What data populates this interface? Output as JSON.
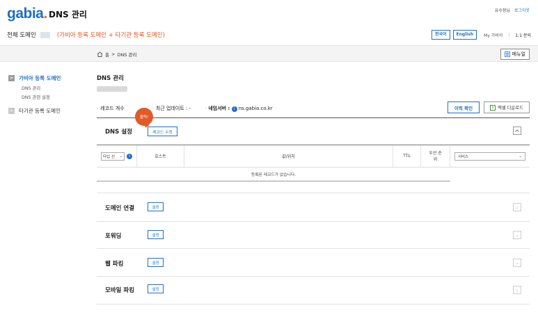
{
  "header": {
    "logo_text": "gabia",
    "logo_dot": ".",
    "title": "DNS 관리",
    "user_name": "유수정님",
    "logout": "로그아웃"
  },
  "domain_bar": {
    "label": "전체 도메인",
    "types": "(가비아 등록 도메인 + 타기관 등록 도메인)",
    "lang_ko": "한국어",
    "lang_en": "English",
    "my_gabia": "My 가비아",
    "separator": "|",
    "inquiry": "1:1 문의"
  },
  "breadcrumb": {
    "home": "홈",
    "separator": ">",
    "current": "DNS 관리"
  },
  "menu_button": "메뉴얼",
  "sidebar": {
    "items": [
      {
        "label": "가비아 등록 도메인",
        "arrow": ">"
      },
      {
        "label": "타기관 등록 도메인",
        "arrow": ">"
      }
    ],
    "subitems": [
      "DNS 관리",
      "DNS 관련 설정"
    ]
  },
  "main": {
    "title": "DNS 관리",
    "record_count_label": "레코드 개수",
    "updated_label": "최근 업데이트 : -",
    "ns_label": "네임서버 :",
    "ns_value": "ns.gabia.co.kr",
    "history_button": "이력 확인",
    "excel_button": "엑셀 다운로드",
    "bubble": "클릭!"
  },
  "dns_settings": {
    "title": "DNS 설정",
    "record_edit_button": "레코드 수정",
    "columns": {
      "type_select": "타입 선",
      "host": "호스트",
      "value": "값/위치",
      "ttl": "TTL",
      "priority": "우선 순위",
      "service_select": "서비스"
    },
    "empty_message": "등록된 레코드가 없습니다."
  },
  "sections": [
    {
      "title": "도메인 연결",
      "button": "설정"
    },
    {
      "title": "포워딩",
      "button": "설정"
    },
    {
      "title": "웹 파킹",
      "button": "설정"
    },
    {
      "title": "모바일 파킹",
      "button": "설정"
    }
  ],
  "icons": {
    "info": "info-icon",
    "home": "home-icon",
    "menu": "menu-icon",
    "excel": "excel-icon",
    "chevron_down": "chevron-down-icon",
    "chevron_up": "chevron-up-icon"
  },
  "colors": {
    "brand_blue": "#1f6ec7",
    "accent_orange": "#e8541c",
    "bubble_orange": "#e25a2a"
  }
}
